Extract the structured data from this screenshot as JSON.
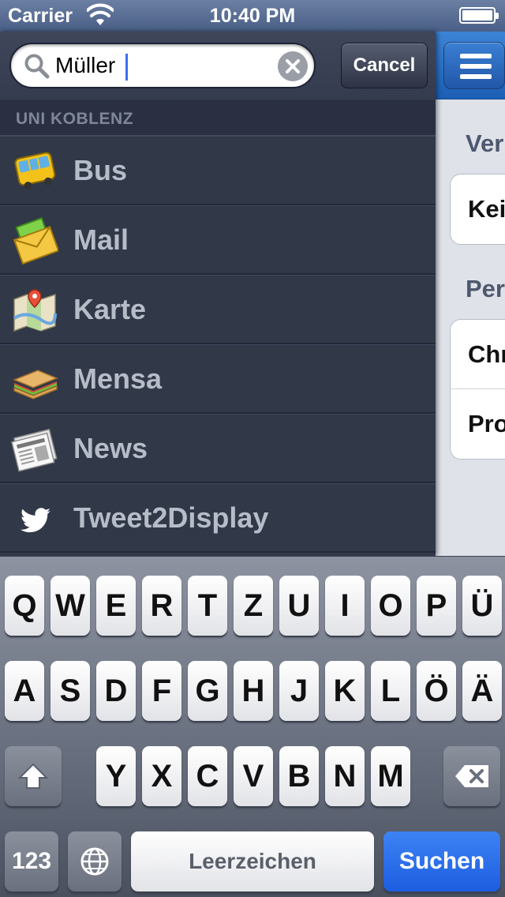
{
  "status_bar": {
    "carrier": "Carrier",
    "time": "10:40 PM",
    "battery_level": 1.0
  },
  "search": {
    "query": "Müller",
    "cancel_label": "Cancel"
  },
  "sidebar": {
    "section_title": "UNI KOBLENZ",
    "items": [
      {
        "label": "Bus",
        "icon": "bus-icon"
      },
      {
        "label": "Mail",
        "icon": "mail-icon"
      },
      {
        "label": "Karte",
        "icon": "map-icon"
      },
      {
        "label": "Mensa",
        "icon": "sandwich-icon"
      },
      {
        "label": "News",
        "icon": "newspaper-icon"
      },
      {
        "label": "Tweet2Display",
        "icon": "twitter-bird-icon"
      }
    ]
  },
  "main": {
    "section1_head": "Ver",
    "section1_cells": [
      "Kei"
    ],
    "section2_head": "Per",
    "section2_cells": [
      "Chr",
      "Pro"
    ]
  },
  "keyboard": {
    "row1": [
      "Q",
      "W",
      "E",
      "R",
      "T",
      "Z",
      "U",
      "I",
      "O",
      "P",
      "Ü"
    ],
    "row2": [
      "A",
      "S",
      "D",
      "F",
      "G",
      "H",
      "J",
      "K",
      "L",
      "Ö",
      "Ä"
    ],
    "row3": [
      "Y",
      "X",
      "C",
      "V",
      "B",
      "N",
      "M"
    ],
    "numbers_label": "123",
    "space_label": "Leerzeichen",
    "return_label": "Suchen"
  },
  "colors": {
    "sidebar_bg": "#313848",
    "nav_blue": "#2a6fc4",
    "return_key_blue": "#2566e8"
  }
}
